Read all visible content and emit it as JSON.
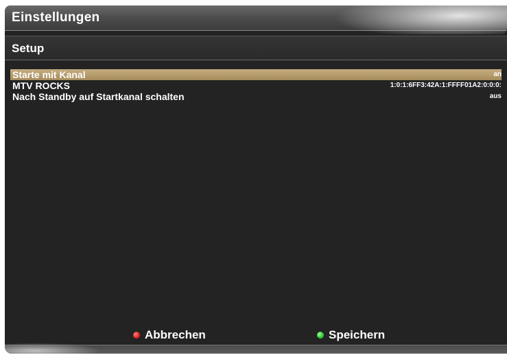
{
  "window": {
    "title": "Einstellungen"
  },
  "section": {
    "title": "Setup"
  },
  "settings": [
    {
      "label": "Starte mit Kanal",
      "value": "an",
      "selected": true
    },
    {
      "label": "MTV ROCKS",
      "value": "1:0:1:6FF3:42A:1:FFFF01A2:0:0:0:",
      "selected": false
    },
    {
      "label": "Nach Standby auf Startkanal schalten",
      "value": "aus",
      "selected": false
    }
  ],
  "footer": {
    "cancel": {
      "label": "Abbrechen",
      "color": "#e02020"
    },
    "save": {
      "label": "Speichern",
      "color": "#2ec02e"
    }
  }
}
